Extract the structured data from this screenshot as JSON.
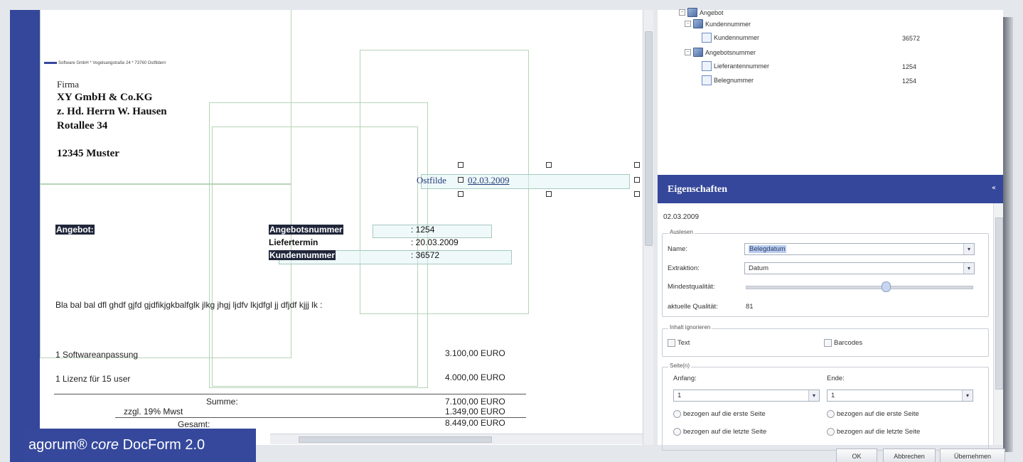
{
  "document": {
    "sender_line": "Software GmbH * Vogelsangstraße 24 * 73760 Ostfildern",
    "address": {
      "label": "Firma",
      "company": "XY GmbH & Co.KG",
      "attn": "z. Hd. Herrn W. Hausen",
      "street": "Rotallee 34",
      "city": "12345 Muster"
    },
    "place": "Ostfilde",
    "date": "02.03.2009",
    "offer_title": "Angebot:",
    "fields": [
      {
        "label": "Angebotsnummer",
        "value": ": 1254"
      },
      {
        "label": "Liefertermin",
        "value": ": 20.03.2009"
      },
      {
        "label": "Kundennummer",
        "value": ": 36572"
      }
    ],
    "body_text": "Bla bal bal dfl ghdf gjfd gjdfikjgkbalfglk jlkg jhgj  ljdfv lkjdfgl jj dfjdf kjjj lk :",
    "items": [
      {
        "desc": "1 Softwareanpassung",
        "amount": "3.100,00 EURO"
      },
      {
        "desc": "1 Lizenz für 15 user",
        "amount": "4.000,00 EURO"
      }
    ],
    "totals": [
      {
        "label": "Summe:",
        "amount": "7.100,00 EURO"
      },
      {
        "label": "zzgl. 19% Mwst",
        "amount": "1.349,00 EURO"
      },
      {
        "label": "Gesamt:",
        "amount": "8.449,00 EURO"
      }
    ]
  },
  "tree": {
    "items": [
      {
        "label": "Angebot"
      },
      {
        "label": "Kundennummer"
      },
      {
        "label": "Kundennummer",
        "value": "36572"
      },
      {
        "label": "Angebotsnummer"
      },
      {
        "label": "Lieferantennummer",
        "value": "1254"
      },
      {
        "label": "Belegnummer",
        "value": "1254"
      }
    ]
  },
  "panel": {
    "title": "Eigenschaften",
    "collapse": "«",
    "value": "02.03.2009",
    "auslesen": {
      "legend": "Auslesen",
      "name_label": "Name:",
      "name_value": "Belegdatum",
      "extraktion_label": "Extraktion:",
      "extraktion_value": "Datum",
      "mindest_label": "Mindestqualität:",
      "mindest_level": 0.62,
      "aktuelle_label": "aktuelle Qualität:",
      "aktuelle_value": "81"
    },
    "ignorieren": {
      "legend": "Inhalt ignorieren",
      "text": "Text",
      "barcodes": "Barcodes"
    },
    "seite": {
      "legend": "Seite(n)",
      "anfang_label": "Anfang:",
      "ende_label": "Ende:",
      "anfang_value": "1",
      "ende_value": "1",
      "opt_first": "bezogen auf die erste Seite",
      "opt_last": "bezogen auf die letzte Seite"
    }
  },
  "buttons": {
    "ok": "OK",
    "cancel": "Abbrechen",
    "apply": "Übernehmen"
  },
  "brand": {
    "prefix": "agorum® ",
    "italic": "core",
    "suffix": " DocForm 2.0"
  }
}
